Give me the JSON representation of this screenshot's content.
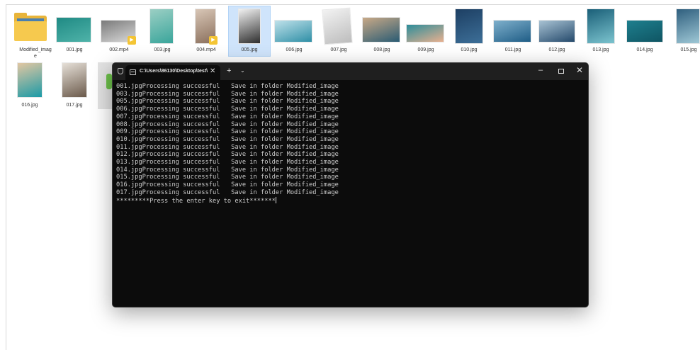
{
  "files": [
    {
      "name": "Modified_imag\ne",
      "kind": "folder"
    },
    {
      "name": "001.jpg",
      "kind": "image",
      "colors": [
        "#1f8a84",
        "#4fb3a9"
      ]
    },
    {
      "name": "002.mp4",
      "kind": "video",
      "colors": [
        "#7a7a7a",
        "#d9d9d9"
      ]
    },
    {
      "name": "003.jpg",
      "kind": "image",
      "colors": [
        "#9bcfc4",
        "#3aa59b"
      ]
    },
    {
      "name": "004.mp4",
      "kind": "video",
      "colors": [
        "#d8c6b6",
        "#8a6f5c"
      ]
    },
    {
      "name": "005.jpg",
      "kind": "image",
      "colors": [
        "#f1f1f1",
        "#2e2e2e"
      ]
    },
    {
      "name": "006.jpg",
      "kind": "image",
      "colors": [
        "#bfe1ea",
        "#2f8fa6"
      ]
    },
    {
      "name": "007.jpg",
      "kind": "image",
      "colors": [
        "#f2f2f2",
        "#bdbdbd"
      ]
    },
    {
      "name": "008.jpg",
      "kind": "image",
      "colors": [
        "#c9a987",
        "#2a5b73"
      ]
    },
    {
      "name": "009.jpg",
      "kind": "image",
      "colors": [
        "#2c8d9a",
        "#e8b08f"
      ]
    },
    {
      "name": "010.jpg",
      "kind": "image",
      "colors": [
        "#1d3f63",
        "#3d6f98"
      ]
    },
    {
      "name": "011.jpg",
      "kind": "image",
      "colors": [
        "#7fb0cc",
        "#1f5d86"
      ]
    },
    {
      "name": "012.jpg",
      "kind": "image",
      "colors": [
        "#a9c3d4",
        "#24496b"
      ]
    },
    {
      "name": "013.jpg",
      "kind": "image",
      "colors": [
        "#1a5f78",
        "#7cc4cf"
      ]
    },
    {
      "name": "014.jpg",
      "kind": "image",
      "colors": [
        "#1e7f8e",
        "#0f5563"
      ]
    },
    {
      "name": "015.jpg",
      "kind": "image",
      "colors": [
        "#2f5f7e",
        "#9fc8d6"
      ]
    },
    {
      "name": "016.jpg",
      "kind": "image",
      "colors": [
        "#e3c7a2",
        "#1b9aa6"
      ]
    },
    {
      "name": "017.jpg",
      "kind": "image",
      "colors": [
        "#e6e0d8",
        "#6b5a4b"
      ]
    }
  ],
  "terminal": {
    "tab_title": "C:\\Users\\86130\\Desktop\\test\\",
    "tab_close": "✕",
    "new_tab": "+",
    "dropdown": "⌄",
    "minimize": "–",
    "close": "✕",
    "lines": [
      "001.jpgProcessing successful   Save in folder Modified_image",
      "003.jpgProcessing successful   Save in folder Modified_image",
      "005.jpgProcessing successful   Save in folder Modified_image",
      "006.jpgProcessing successful   Save in folder Modified_image",
      "007.jpgProcessing successful   Save in folder Modified_image",
      "008.jpgProcessing successful   Save in folder Modified_image",
      "009.jpgProcessing successful   Save in folder Modified_image",
      "010.jpgProcessing successful   Save in folder Modified_image",
      "011.jpgProcessing successful   Save in folder Modified_image",
      "012.jpgProcessing successful   Save in folder Modified_image",
      "013.jpgProcessing successful   Save in folder Modified_image",
      "014.jpgProcessing successful   Save in folder Modified_image",
      "015.jpgProcessing successful   Save in folder Modified_image",
      "016.jpgProcessing successful   Save in folder Modified_image",
      "017.jpgProcessing successful   Save in folder Modified_image"
    ],
    "prompt": "*********Press the enter key to exit*******"
  }
}
